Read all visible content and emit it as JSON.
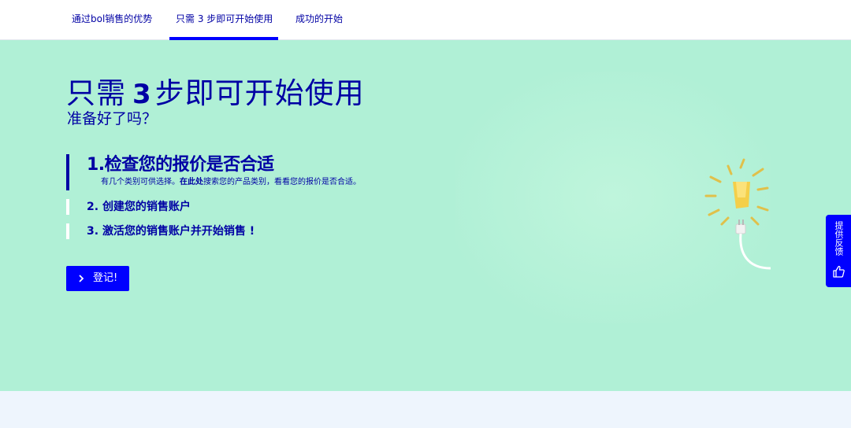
{
  "nav": {
    "tabs": [
      {
        "label": "通过bol销售的优势"
      },
      {
        "label": "只需 3 步即可开始使用",
        "active": true
      },
      {
        "label": "成功的开始"
      }
    ]
  },
  "hero": {
    "title_pre": "只需",
    "title_num": "3",
    "title_post": "步即可开始使用",
    "subtitle": "准备好了吗？",
    "steps": [
      {
        "num": "1.",
        "title": "检查您的报价是否合适",
        "desc_pre": "有几个类别可供选择。",
        "desc_link": "在此处",
        "desc_post": "搜索您的产品类别，看看您的报价是否合适。",
        "active": true
      },
      {
        "num": "2.",
        "title": "创建您的销售账户"
      },
      {
        "num": "3.",
        "title": "激活您的销售账户并开始销售 !"
      }
    ],
    "cta_label": "登记!",
    "cta_icon": "chevron-right-icon",
    "illustration_icon": "lightbulb-plug-icon"
  },
  "feedback": {
    "label": "提供反馈",
    "icon": "thumbs-up-icon"
  },
  "colors": {
    "hero_bg": "#b0f0d6",
    "brand_blue": "#0000ff",
    "text_navy": "#0000a4",
    "page_bg": "#eef5fd"
  }
}
